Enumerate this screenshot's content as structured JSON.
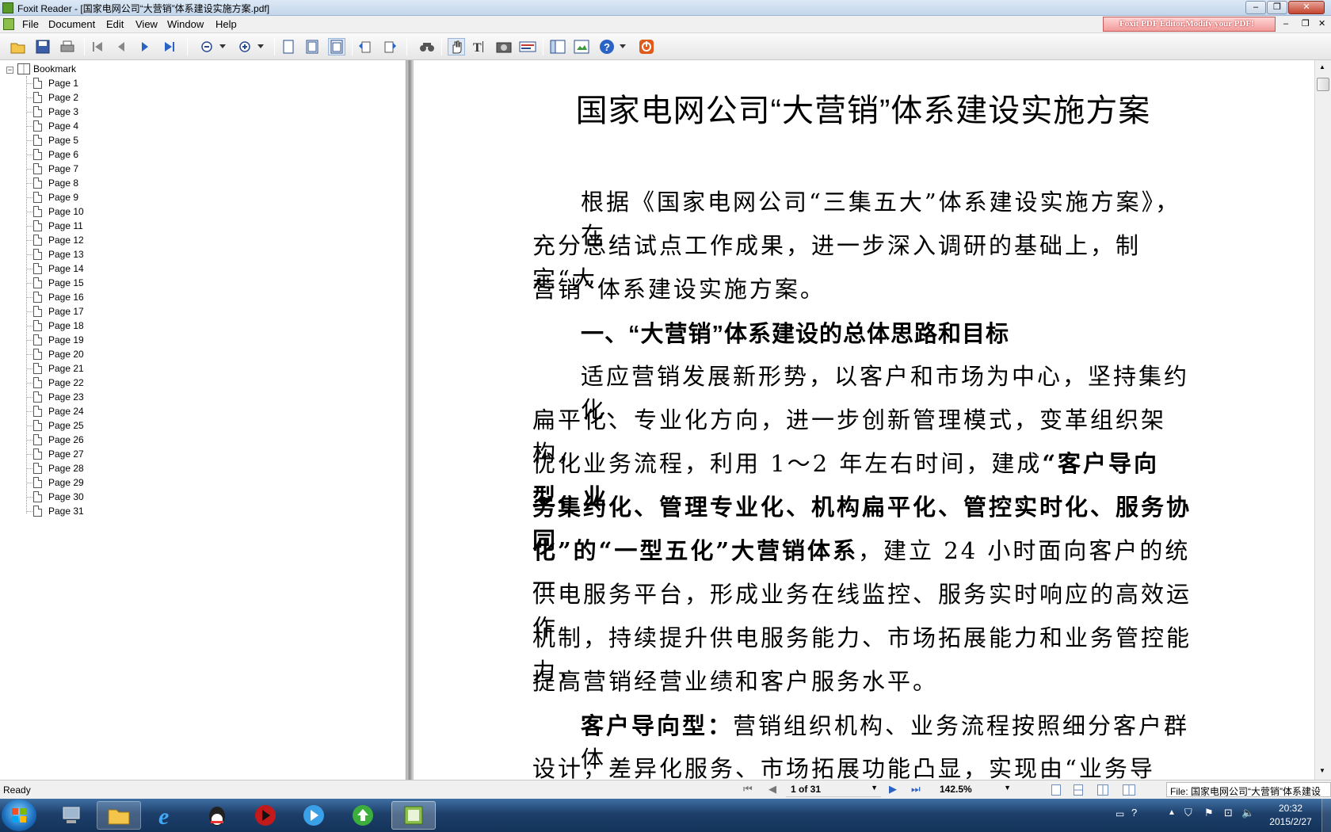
{
  "window": {
    "title": "Foxit Reader - [国家电网公司“大营销”体系建设实施方案.pdf]",
    "min": "‒",
    "max": "❐",
    "close": "✕"
  },
  "menu": [
    "File",
    "Document",
    "Edit",
    "View",
    "Window",
    "Help"
  ],
  "ad_banner": "Foxit PDF Editor,Modify your PDF!",
  "toolbar_icons": [
    "open-icon",
    "save-icon",
    "print-icon",
    "first-page-icon",
    "prev-page-icon",
    "next-page-icon",
    "last-page-icon",
    "zoom-out-icon",
    "zoom-in-icon",
    "single-page-icon",
    "continuous-icon",
    "facing-icon",
    "rotate-left-icon",
    "rotate-right-icon",
    "find-icon",
    "hand-icon",
    "select-text-icon",
    "snapshot-icon",
    "typewriter-icon",
    "bookmarks-panel-icon",
    "thumbnail-icon",
    "help-icon",
    "stop-icon"
  ],
  "bookmark": {
    "root": "Bookmark",
    "pages": [
      "Page 1",
      "Page 2",
      "Page 3",
      "Page 4",
      "Page 5",
      "Page 6",
      "Page 7",
      "Page 8",
      "Page 9",
      "Page 10",
      "Page 11",
      "Page 12",
      "Page 13",
      "Page 14",
      "Page 15",
      "Page 16",
      "Page 17",
      "Page 18",
      "Page 19",
      "Page 20",
      "Page 21",
      "Page 22",
      "Page 23",
      "Page 24",
      "Page 25",
      "Page 26",
      "Page 27",
      "Page 28",
      "Page 29",
      "Page 30",
      "Page 31"
    ]
  },
  "doc": {
    "title": "国家电网公司“大营销”体系建设实施方案",
    "lines": [
      "根据《国家电网公司“三集五大”体系建设实施方案》，在",
      "充分总结试点工作成果，进一步深入调研的基础上，制定“大",
      "营销”体系建设实施方案。",
      "一、“大营销”体系建设的总体思路和目标",
      "适应营销发展新形势，以客户和市场为中心，坚持集约化、",
      "扁平化、专业化方向，进一步创新管理模式，变革组织架构，",
      "优化业务流程，利用 1～2 年左右时间，建成",
      "“客户导向型、业",
      "务集约化、管理专业化、机构扁平化、管控实时化、服务协同",
      "化”的“一型五化”大营销体系",
      "，建立 24 小时面向客户的统一",
      "供电服务平台，形成业务在线监控、服务实时响应的高效运作",
      "机制，持续提升供电服务能力、市场拓展能力和业务管控能力，",
      "提高营销经营业绩和客户服务水平。",
      "客户导向型：",
      "营销组织机构、业务流程按照细分客户群体",
      "设计，差异化服务、市场拓展功能凸显，实现由“业务导向”"
    ]
  },
  "status": {
    "ready": "Ready",
    "page": "1 of 31",
    "zoom": "142.5%",
    "file": "File: 国家电网公司“大营销”体系建设"
  },
  "taskbar": {
    "time": "20:32",
    "date": "2015/2/27"
  }
}
